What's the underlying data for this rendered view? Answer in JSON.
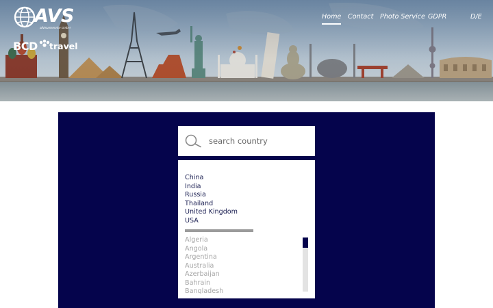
{
  "header": {
    "logo_avs": "AVS",
    "logo_avs_sub": "allvisumservice GmbH",
    "logo_bcd": "BCD",
    "logo_bcd_sub": "travel",
    "nav": [
      {
        "label": "Home",
        "active": true
      },
      {
        "label": "Contact",
        "active": false
      },
      {
        "label": "Photo Service",
        "active": false
      },
      {
        "label": "GDPR",
        "active": false
      },
      {
        "label": "D/E",
        "active": false
      }
    ]
  },
  "search": {
    "placeholder": "search country",
    "value": "",
    "icon": "search-icon"
  },
  "countries": {
    "featured": [
      "China",
      "India",
      "Russia",
      "Thailand",
      "United Kingdom",
      "USA"
    ],
    "all": [
      "Algeria",
      "Angola",
      "Argentina",
      "Australia",
      "Azerbaijan",
      "Bahrain",
      "Bangladesh"
    ],
    "scroll_position": 0
  },
  "colors": {
    "panel": "#05044c",
    "featured_text": "#1b1f52",
    "muted_text": "#a6a6a6",
    "divider": "#9b9b9b"
  }
}
